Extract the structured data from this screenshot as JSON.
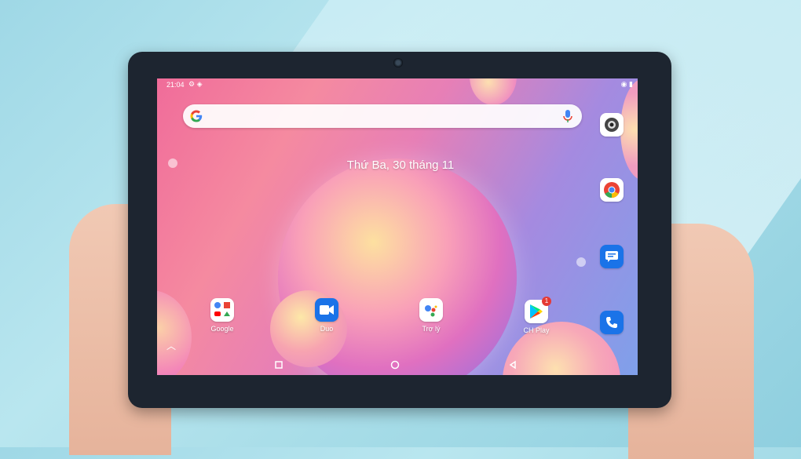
{
  "status_bar": {
    "time": "21:04"
  },
  "search": {
    "placeholder": ""
  },
  "home": {
    "date": "Thứ Ba, 30 tháng 11"
  },
  "apps": [
    {
      "label": "Google"
    },
    {
      "label": "Duo"
    },
    {
      "label": "Trợ lý"
    },
    {
      "label": "CH Play",
      "badge": "1"
    }
  ],
  "colors": {
    "duo": "#1a73e8",
    "messages": "#1a73e8",
    "phone": "#1a73e8"
  }
}
